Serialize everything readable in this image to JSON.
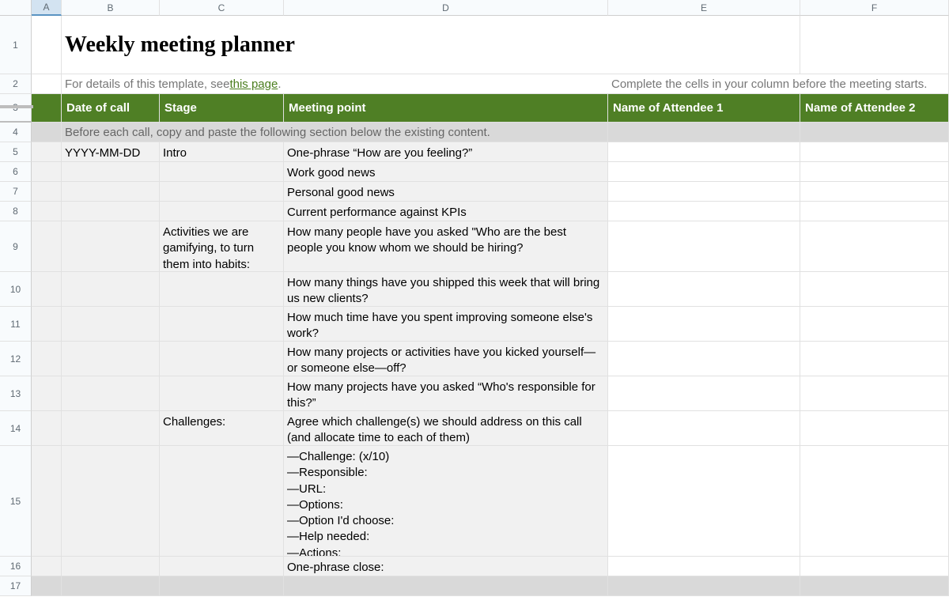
{
  "columns": [
    "A",
    "B",
    "C",
    "D",
    "E",
    "F"
  ],
  "rows": [
    "1",
    "2",
    "3",
    "4",
    "5",
    "6",
    "7",
    "8",
    "9",
    "10",
    "11",
    "12",
    "13",
    "14",
    "15",
    "16",
    "17"
  ],
  "title": "Weekly meeting planner",
  "subtext_prefix": "For details of this template, see ",
  "subtext_link": "this page",
  "subtext_suffix": ".",
  "right_note": "Complete the cells in your column before the meeting starts.",
  "headers": {
    "b": "Date of call",
    "c": "Stage",
    "d": "Meeting point",
    "e": "Name of Attendee 1",
    "f": "Name of Attendee 2"
  },
  "instruction": "Before each call, copy and paste the following section below the existing content.",
  "r5": {
    "b": "YYYY-MM-DD",
    "c": "Intro",
    "d": "One-phrase “How are you feeling?”"
  },
  "r6": {
    "d": "Work good news"
  },
  "r7": {
    "d": "Personal good news"
  },
  "r8": {
    "d": "Current performance against KPIs"
  },
  "r9": {
    "c": "Activities we are gamifying, to turn them into habits:",
    "d": "How many people have you asked \"Who are the best people you know whom we should be hiring?"
  },
  "r10": {
    "d": "How many things have you shipped this week that will bring us new clients?"
  },
  "r11": {
    "d": "How much time have you spent improving someone else's work?"
  },
  "r12": {
    "d": "How many projects or activities have you kicked yourself—or someone else—off?"
  },
  "r13": {
    "d": "How many projects have you asked “Who's responsible for this?”"
  },
  "r14": {
    "c": "Challenges:",
    "d": "Agree which challenge(s) we should address on this call (and allocate time to each of them)"
  },
  "r15": {
    "d": "—Challenge: (x/10)\n—Responsible:\n—URL:\n—Options:\n—Option I'd choose:\n—Help needed:\n—Actions:"
  },
  "r16": {
    "d": "One-phrase close:"
  }
}
